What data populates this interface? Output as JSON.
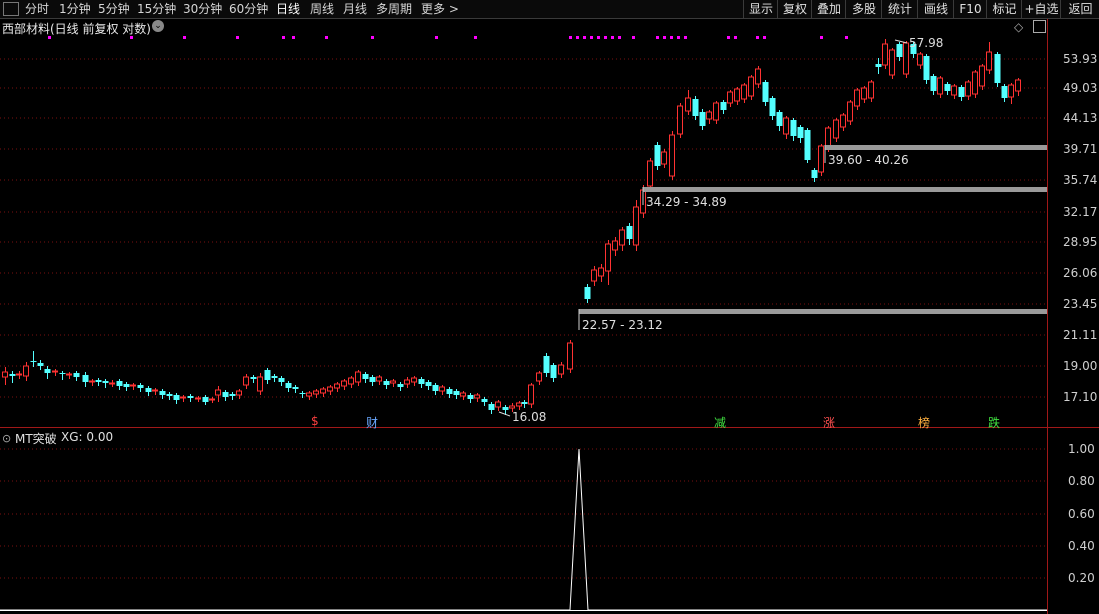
{
  "toolbar": {
    "left_items": [
      "分时",
      "1分钟",
      "5分钟",
      "15分钟",
      "30分钟",
      "60分钟",
      "日线",
      "周线",
      "月线",
      "多周期",
      "更多 >"
    ],
    "active_index": 6,
    "right_items": [
      "显示",
      "复权",
      "叠加",
      "多股",
      "统计",
      "画线",
      "F10",
      "标记",
      "+自选",
      "返回"
    ]
  },
  "main": {
    "stock_name": "西部材料",
    "mode": "(日线 前复权 对数)",
    "price_axis": [
      "53.93",
      "49.03",
      "44.13",
      "39.71",
      "35.74",
      "32.17",
      "28.95",
      "26.06",
      "23.45",
      "21.11",
      "19.00",
      "17.10"
    ],
    "high_label": "57.98",
    "low_label": "16.08",
    "zones": [
      {
        "label": "22.57 - 23.12"
      },
      {
        "label": "34.29 - 34.89"
      },
      {
        "label": "39.60 - 40.26"
      }
    ],
    "markers": [
      {
        "text": "$",
        "color": "#ff4040"
      },
      {
        "text": "财",
        "color": "#6aa8ff"
      },
      {
        "text": "减",
        "color": "#40e040"
      },
      {
        "text": "涨",
        "color": "#ff5050"
      },
      {
        "text": "榜",
        "color": "#ffb040"
      },
      {
        "text": "跌",
        "color": "#40e040"
      }
    ]
  },
  "indicator": {
    "title": "MT突破",
    "xg_label": "XG: 0.00",
    "axis": [
      "1.00",
      "0.80",
      "0.60",
      "0.40",
      "0.20"
    ]
  },
  "colors": {
    "up": "#ff3232",
    "down": "#54ffff",
    "dot": "#ff00ff",
    "grid": "#7a1010",
    "axis": "#a01818",
    "zone": "#9a9a9a"
  }
}
